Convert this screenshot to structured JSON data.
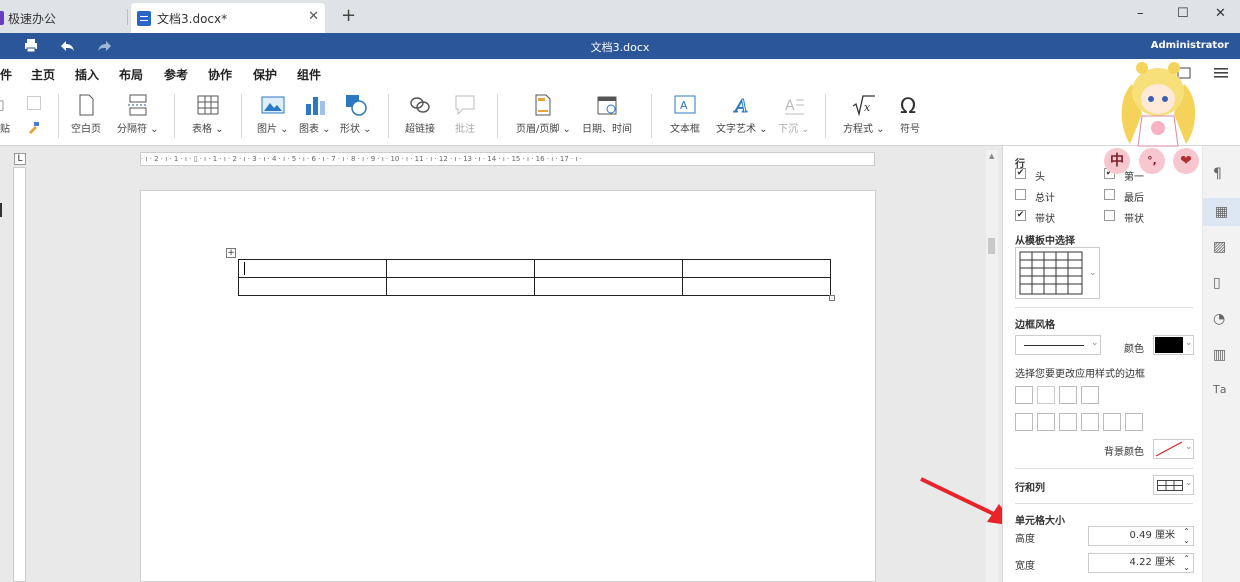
{
  "tabs": {
    "home": "极速办公",
    "doc": "文档3.docx*",
    "close": "✕",
    "new": "+"
  },
  "window": {
    "min": "–",
    "max": "☐",
    "close": "✕"
  },
  "title_bar": {
    "title": "文档3.docx",
    "user": "Administrator"
  },
  "menu": {
    "file": "件",
    "home": "主页",
    "insert": "插入",
    "layout": "布局",
    "references": "参考",
    "collab": "协作",
    "protect": "保护",
    "plugins": "组件"
  },
  "ribbon": {
    "paste": "贴",
    "blank_page": "空白页",
    "break": "分隔符",
    "table": "表格",
    "image": "图片",
    "chart": "图表",
    "shape": "形状",
    "hyperlink": "超链接",
    "comment": "批注",
    "header_footer": "页眉/页脚",
    "datetime": "日期、时间",
    "textbox": "文本框",
    "textart": "文字艺术",
    "dropcap": "下沉",
    "equation": "方程式",
    "symbol": "符号"
  },
  "ruler": {
    "h_ticks": "· ı · 2 · ı · 1 · ı · ▯ · ı · 1 · ı · 2 · ı · 3 · ı · 4 · ı · 5 · ı · 6 · ı · 7 · ı · 8 · ı · 9 · ı · 10 · ı · 11 · ı · 12 · ı · 13 · ı · 14 · ı · 15 · ı · 16 · ı · 17 · ı ·",
    "corner": "L"
  },
  "panel": {
    "rows_heading": "行",
    "header_row": "头",
    "first_col": "第一",
    "total_row": "总计",
    "last_col": "最后",
    "banded_rows": "带状",
    "banded_cols": "带状",
    "template_heading": "从模板中选择",
    "border_style_heading": "边框风格",
    "color_label": "颜色",
    "border_hint": "选择您要更改应用样式的边框",
    "bg_color_label": "背景颜色",
    "rows_cols_heading": "行和列",
    "cell_size_heading": "单元格大小",
    "height_label": "高度",
    "height_value": "0.49 厘米",
    "width_label": "宽度",
    "width_value": "4.22 厘米",
    "checked_header": true,
    "checked_banded_rows": true,
    "border_color": "#000000",
    "bg_none_color": "#e02020"
  },
  "floating": {
    "zh": "中",
    "punct": "°,",
    "heart": "❤"
  },
  "annotation": {
    "arrow_color": "#e8232a"
  }
}
